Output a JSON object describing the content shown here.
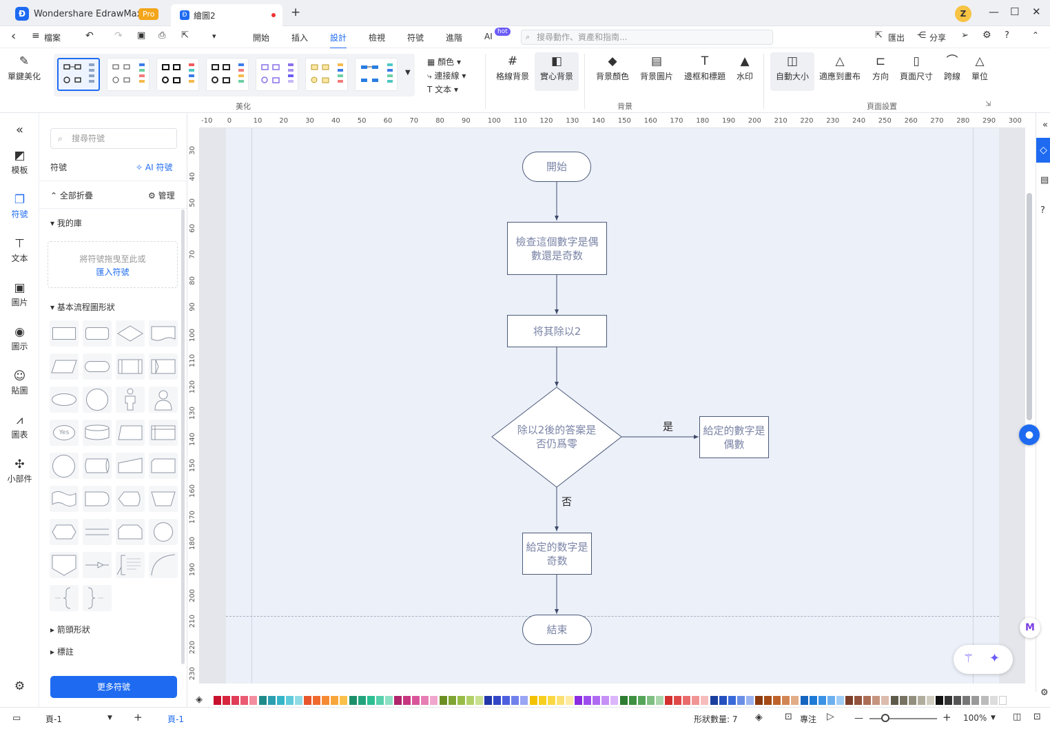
{
  "titlebar": {
    "app_name": "Wondershare EdrawMax",
    "badge": "Pro",
    "doc_tab": "繪圖2",
    "new_tab": "+",
    "user_initial": "Z",
    "min": "—",
    "max": "☐",
    "close": "✕"
  },
  "menubar": {
    "back": "‹",
    "file": "檔案",
    "items": [
      "開始",
      "插入",
      "設計",
      "檢視",
      "符號",
      "進階",
      "AI"
    ],
    "active": "設計",
    "ai_badge": "hot",
    "search_placeholder": "搜尋動作、資產和指南...",
    "export": "匯出",
    "share": "分享"
  },
  "ribbon": {
    "beautify": "單鍵美化",
    "theme_dropdowns": [
      "顏色",
      "連接線",
      "文本"
    ],
    "group_beautify": "美化",
    "grid_bg": "格線背景",
    "solid_bg": "實心背景",
    "bg_color": "背景顏色",
    "bg_image": "背景圖片",
    "border_title": "邊框和標題",
    "watermark": "水印",
    "group_background": "背景",
    "auto_size": "自動大小",
    "fit_canvas": "適應到畫布",
    "orientation": "方向",
    "page_size": "頁面尺寸",
    "jump": "跨線",
    "unit": "單位",
    "group_page": "頁面設置"
  },
  "leftrail": {
    "collapse": "«",
    "items": [
      "模板",
      "符號",
      "文本",
      "圖片",
      "圖示",
      "貼圖",
      "圖表",
      "小部件"
    ],
    "active": "符號"
  },
  "panel": {
    "search_placeholder": "搜尋符號",
    "title": "符號",
    "ai_symbol": "AI 符號",
    "collapse_all": "全部折疊",
    "manage": "管理",
    "my_library": "我的庫",
    "drop_hint": "將符號拖曳至此或",
    "import": "匯入符號",
    "basic_flowchart": "基本流程圖形狀",
    "arrow_shapes": "箭頭形狀",
    "callouts": "標註",
    "more": "更多符號",
    "yes_shape": "Yes"
  },
  "ruler": {
    "h": [
      "-10",
      "0",
      "10",
      "20",
      "30",
      "40",
      "50",
      "60",
      "70",
      "80",
      "90",
      "100",
      "110",
      "120",
      "130",
      "140",
      "150",
      "160",
      "170",
      "180",
      "190",
      "200",
      "210",
      "220",
      "230",
      "240",
      "250",
      "260",
      "270",
      "280",
      "290",
      "300"
    ],
    "v": [
      "30",
      "40",
      "50",
      "60",
      "70",
      "80",
      "90",
      "100",
      "110",
      "120",
      "130",
      "140",
      "150",
      "160",
      "170",
      "180",
      "190",
      "200",
      "210",
      "220",
      "230"
    ]
  },
  "flowchart": {
    "start": "開始",
    "check": "檢查這個數字是偶數還是奇数",
    "divide": "将其除以2",
    "decision": "除以2後的答案是否仍爲零",
    "yes": "是",
    "no": "否",
    "even": "給定的數字是偶數",
    "odd": "給定的数字是奇数",
    "end": "結束"
  },
  "palette": [
    "#c8102e",
    "#d7263d",
    "#e03b57",
    "#ea5a73",
    "#f28ea0",
    "#1f8a8a",
    "#2b9fb0",
    "#37b5c8",
    "#5fcbdb",
    "#8fdbe6",
    "#e8552b",
    "#f06a2e",
    "#f58a32",
    "#f7a63b",
    "#f9c14a",
    "#1b8f6a",
    "#22a57c",
    "#2cbf92",
    "#57d1ab",
    "#8ee0c5",
    "#b0246b",
    "#c7367f",
    "#d9559a",
    "#e67db5",
    "#f0a6cd",
    "#6b8e23",
    "#7fa533",
    "#97bd46",
    "#b1d068",
    "#c9e08f",
    "#2137a8",
    "#3346c7",
    "#4d5fe0",
    "#7181ec",
    "#9aa6f3",
    "#f2c200",
    "#f7cf1e",
    "#fad843",
    "#fbe174",
    "#fdeba4",
    "#8a2be2",
    "#9d4ded",
    "#b06af2",
    "#c690f6",
    "#dbb6fa",
    "#2e7d32",
    "#3d9140",
    "#55a659",
    "#7fbf82",
    "#a9d6ab",
    "#d32f2f",
    "#e04848",
    "#ea6b6b",
    "#f19494",
    "#f7bdbd",
    "#1a3e9e",
    "#2451bf",
    "#3a6ad9",
    "#6a8fe6",
    "#9bb4f0",
    "#8b3a0e",
    "#a64b16",
    "#c0632a",
    "#d18654",
    "#e2ad86",
    "#1565c0",
    "#1e7bd6",
    "#3b93e6",
    "#6db0ef",
    "#a0cdf6",
    "#7b3f2a",
    "#94533c",
    "#ad6e56",
    "#c79480",
    "#dcbcad",
    "#5d5a4a",
    "#777362",
    "#938f7e",
    "#b1ad9d",
    "#d0cdc0",
    "#111111",
    "#333333",
    "#555555",
    "#777777",
    "#999999",
    "#bbbbbb",
    "#dddddd",
    "#ffffff"
  ],
  "status": {
    "page_select": "頁-1",
    "add_page": "+",
    "page_tab": "頁-1",
    "shape_count": "形狀數量: 7",
    "focus": "專注",
    "zoom": "100%"
  }
}
